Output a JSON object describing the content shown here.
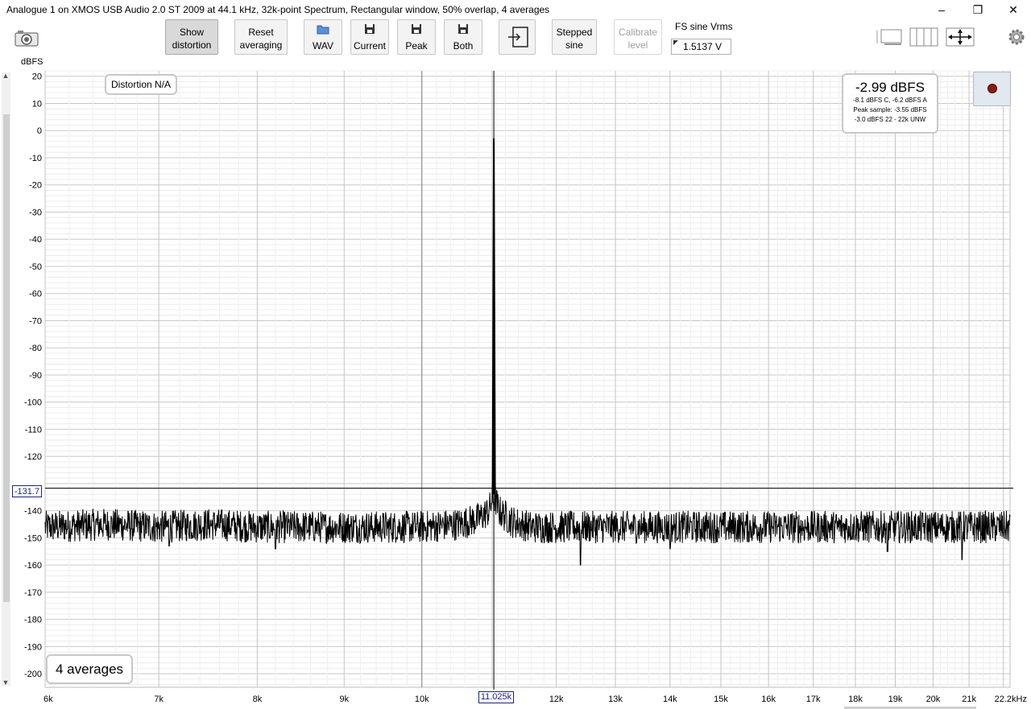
{
  "window": {
    "title": "Analogue 1 on XMOS USB Audio 2.0 ST 2009 at 44.1 kHz, 32k-point Spectrum, Rectangular window, 50% overlap, 4 averages",
    "minimize": "–",
    "maximize": "❐",
    "close": "✕"
  },
  "toolbar": {
    "show_distortion": [
      "Show",
      "distortion"
    ],
    "reset_averaging": [
      "Reset",
      "averaging"
    ],
    "wav": "WAV",
    "current": "Current",
    "peak": "Peak",
    "both": "Both",
    "stepped_sine": [
      "Stepped",
      "sine"
    ],
    "calibrate_level": [
      "Calibrate",
      "level"
    ],
    "fs_label": "FS sine Vrms",
    "fs_value": "1.5137 V"
  },
  "overlays": {
    "distortion": "Distortion N/A",
    "level_main": "-2.99 dBFS",
    "level_lines": [
      "-8.1 dBFS C, -6.2 dBFS A",
      "Peak sample: -3.55 dBFS",
      "-3.0 dBFS 22 - 22k UNW"
    ],
    "averages": "4 averages",
    "cursor_y": "-131.7",
    "cursor_x": "11.025k"
  },
  "chart_data": {
    "type": "line",
    "title": "",
    "xlabel": "",
    "ylabel": "dBFS",
    "x_scale": "log",
    "xlim": [
      6000,
      22200
    ],
    "ylim": [
      -205,
      22
    ],
    "x_ticks": [
      6000,
      7000,
      8000,
      9000,
      10000,
      12000,
      13000,
      14000,
      15000,
      16000,
      17000,
      18000,
      19000,
      20000,
      21000,
      22200
    ],
    "x_tick_labels": [
      "6k",
      "7k",
      "8k",
      "9k",
      "10k",
      "12k",
      "13k",
      "14k",
      "15k",
      "16k",
      "17k",
      "18k",
      "19k",
      "20k",
      "21k",
      "22.2kHz"
    ],
    "y_ticks": [
      20,
      10,
      0,
      -10,
      -20,
      -30,
      -40,
      -50,
      -60,
      -70,
      -80,
      -90,
      -100,
      -110,
      -120,
      -140,
      -150,
      -160,
      -170,
      -180,
      -190,
      -200
    ],
    "grid": true,
    "series": [
      {
        "color": "#000000",
        "noise_floor": -146,
        "peak_frequency": 11025,
        "peak_level": -2.99,
        "points": [
          [
            6000,
            -146
          ],
          [
            6500,
            -145
          ],
          [
            7000,
            -146
          ],
          [
            7500,
            -145
          ],
          [
            8000,
            -146
          ],
          [
            8500,
            -146
          ],
          [
            9000,
            -146
          ],
          [
            9500,
            -146
          ],
          [
            10000,
            -146
          ],
          [
            10500,
            -145
          ],
          [
            10800,
            -143
          ],
          [
            10950,
            -140
          ],
          [
            11000,
            -136
          ],
          [
            11025,
            -2.99
          ],
          [
            11050,
            -136
          ],
          [
            11100,
            -140
          ],
          [
            11300,
            -144
          ],
          [
            11600,
            -146
          ],
          [
            12000,
            -146
          ],
          [
            12400,
            -146
          ],
          [
            13000,
            -146
          ],
          [
            14000,
            -146
          ],
          [
            15000,
            -146
          ],
          [
            16000,
            -146
          ],
          [
            17000,
            -146
          ],
          [
            18000,
            -146
          ],
          [
            19000,
            -146
          ],
          [
            20000,
            -146
          ],
          [
            21000,
            -146
          ],
          [
            22200,
            -146
          ]
        ],
        "dips": [
          [
            7100,
            -153
          ],
          [
            8200,
            -154
          ],
          [
            12400,
            -160
          ],
          [
            14000,
            -154
          ],
          [
            18800,
            -155
          ],
          [
            20800,
            -158
          ]
        ]
      }
    ],
    "cursor": {
      "x": 11025,
      "y": -131.7
    }
  }
}
